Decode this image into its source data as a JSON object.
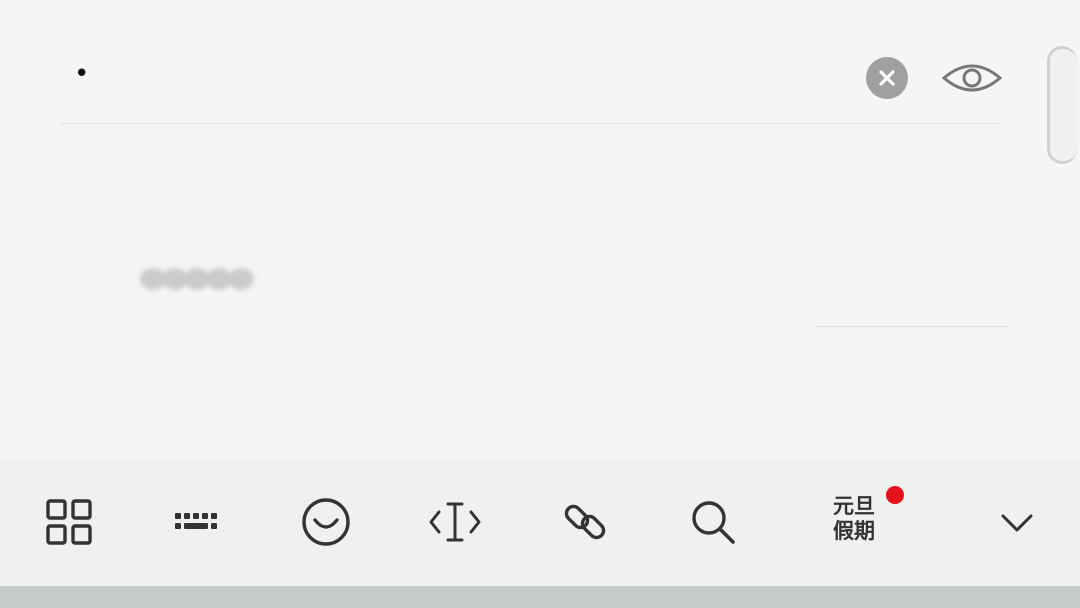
{
  "password_field": {
    "value": "•",
    "clear_icon": "clear-x-icon",
    "visibility_icon": "eye-icon"
  },
  "keyboard_toolbar": {
    "items": [
      {
        "icon": "grid-icon"
      },
      {
        "icon": "keyboard-icon"
      },
      {
        "icon": "emoji-icon"
      },
      {
        "icon": "cursor-icon"
      },
      {
        "icon": "link-icon"
      },
      {
        "icon": "search-icon"
      }
    ],
    "holiday_line1": "元旦",
    "holiday_line2": "假期",
    "collapse_icon": "chevron-down-icon"
  },
  "colors": {
    "background": "#f3f6f3",
    "toolbar": "#eef1ee",
    "badge_red": "#e6121e",
    "icon_dark": "#333333"
  }
}
